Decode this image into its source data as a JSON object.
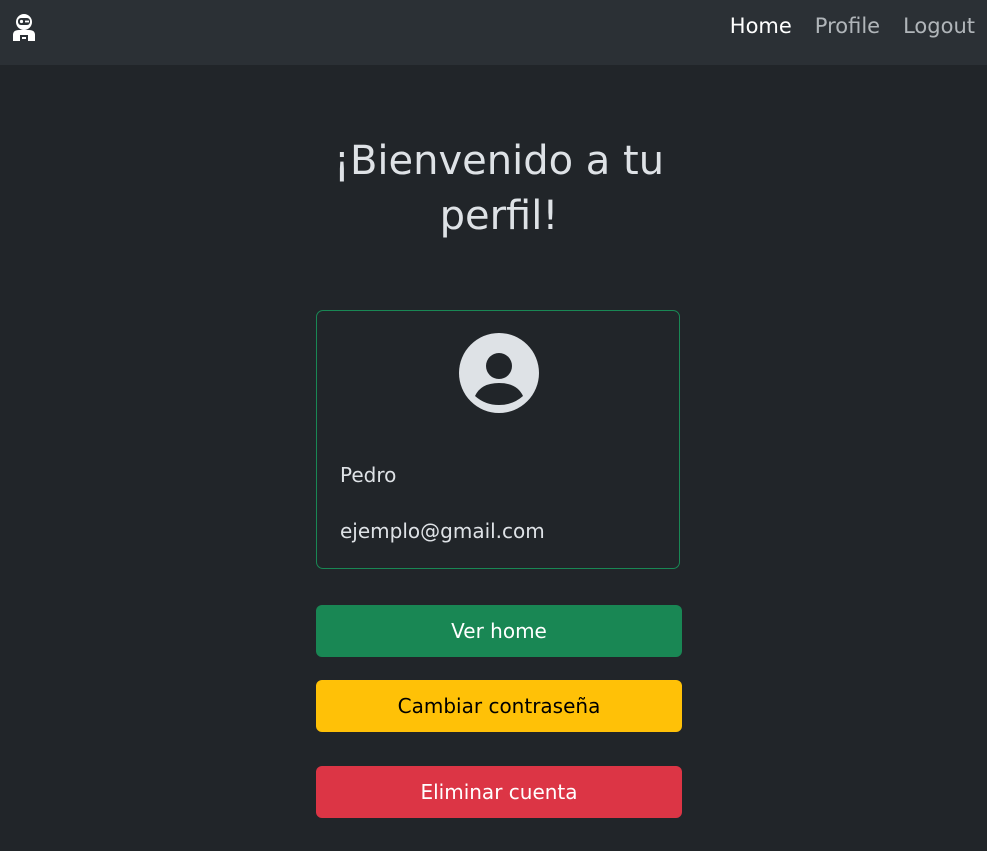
{
  "navbar": {
    "brand_icon": "robot-logo-icon",
    "links": [
      {
        "label": "Home",
        "active": true
      },
      {
        "label": "Profile",
        "active": false
      },
      {
        "label": "Logout",
        "active": false
      }
    ]
  },
  "main": {
    "title": "¡Bienvenido a tu perfil!"
  },
  "profile_card": {
    "avatar_icon": "user-circle-icon",
    "name": "Pedro",
    "email": "ejemplo@gmail.com",
    "border_color": "#198754"
  },
  "actions": {
    "home_label": "Ver home",
    "change_password_label": "Cambiar contraseña",
    "delete_account_label": "Eliminar cuenta"
  },
  "colors": {
    "background": "#212529",
    "navbar": "#2b3035",
    "success": "#198754",
    "warning": "#ffc107",
    "danger": "#dc3545"
  }
}
